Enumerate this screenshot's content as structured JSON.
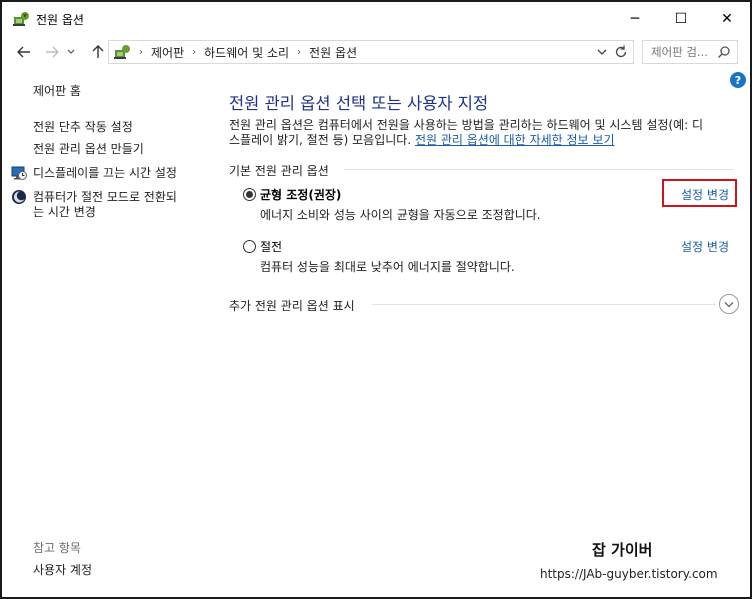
{
  "window": {
    "title": "전원 옵션",
    "controls": {
      "minimize": "─",
      "maximize": "☐",
      "close": "✕"
    }
  },
  "address_bar": {
    "breadcrumbs": [
      "제어판",
      "하드웨어 및 소리",
      "전원 옵션"
    ],
    "search_placeholder": "제어판 검..."
  },
  "sidebar": {
    "home": "제어판 홈",
    "links": [
      {
        "label": "전원 단추 작동 설정"
      },
      {
        "label": "전원 관리 옵션 만들기"
      },
      {
        "label": "디스플레이를 끄는 시간 설정",
        "icon": "display-timer-icon"
      },
      {
        "label_line1": "컴퓨터가 절전 모드로 전환되",
        "label_line2": "는 시간 변경",
        "icon": "sleep-moon-icon"
      }
    ],
    "see_also_title": "참고 항목",
    "see_also_links": [
      "사용자 계정"
    ]
  },
  "main": {
    "heading": "전원 관리 옵션 선택 또는 사용자 지정",
    "description_line1": "전원 관리 옵션은 컴퓨터에서 전원을 사용하는 방법을 관리하는 하드웨어 및 시스템 설정(예: 디",
    "description_line2_prefix": "스플레이 밝기, 절전 등) 모음입니다. ",
    "description_link": "전원 관리 옵션에 대한 자세한 정보 보기",
    "group_label": "기본 전원 관리 옵션",
    "plans": [
      {
        "name": "균형 조정(권장)",
        "description": "에너지 소비와 성능 사이의 균형을 자동으로 조정합니다.",
        "change_label": "설정 변경",
        "selected": true
      },
      {
        "name": "절전",
        "description": "컴퓨터 성능을 최대로 낮추어 에너지를 절약합니다.",
        "change_label": "설정 변경",
        "selected": false
      }
    ],
    "show_more_label": "추가 전원 관리 옵션 표시"
  },
  "watermark": {
    "title": "잡 가이버",
    "url": "https://JAb-guyber.tistory.com"
  },
  "colors": {
    "link": "#1a5ea8",
    "heading": "#1e3287",
    "highlight": "#d0121b"
  }
}
